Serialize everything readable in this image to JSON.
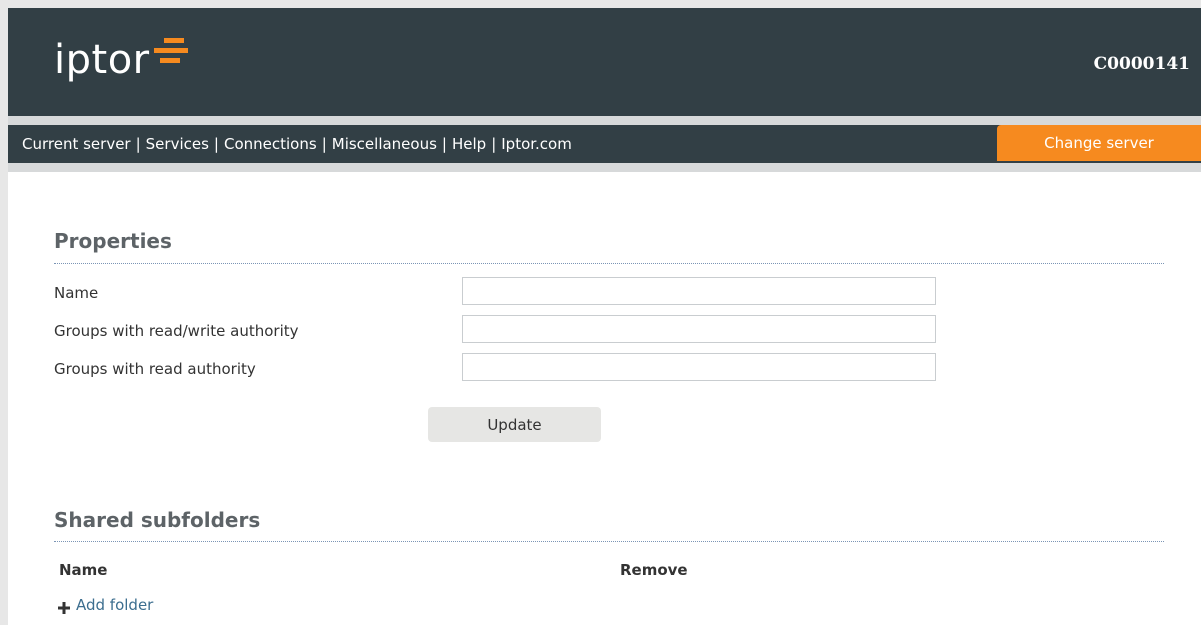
{
  "header": {
    "logo_text": "iptor",
    "server_id": "C0000141",
    "colors": {
      "header_bg": "#323f45",
      "accent": "#f68a1f"
    }
  },
  "nav": {
    "links": [
      {
        "label": "Current server"
      },
      {
        "label": "Services"
      },
      {
        "label": "Connections"
      },
      {
        "label": "Miscellaneous"
      },
      {
        "label": "Help"
      },
      {
        "label": "Iptor.com"
      }
    ],
    "separator": "|",
    "change_server_label": "Change server"
  },
  "properties": {
    "title": "Properties",
    "fields": [
      {
        "label": "Name",
        "value": ""
      },
      {
        "label": "Groups with read/write authority",
        "value": ""
      },
      {
        "label": "Groups with read authority",
        "value": ""
      }
    ],
    "update_label": "Update"
  },
  "shared": {
    "title": "Shared subfolders",
    "columns": [
      "Name",
      "Remove"
    ],
    "add_folder_label": "Add folder",
    "add_folder_icon": "plus-icon"
  }
}
